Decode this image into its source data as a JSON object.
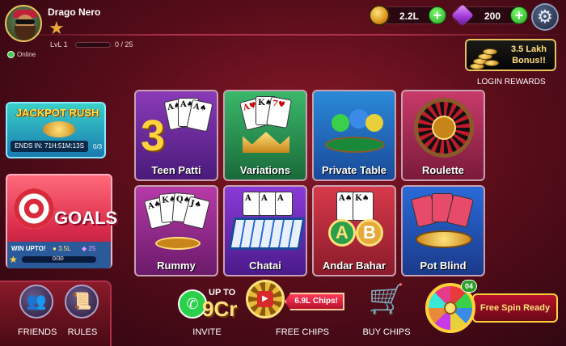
{
  "player": {
    "name": "Drago Nero",
    "level": "LvL 1",
    "xp_progress": "0 / 25",
    "xp_fraction": 0.0,
    "status": "Online"
  },
  "wallet": {
    "coins": "2.2L",
    "gems": "200"
  },
  "login_rewards": {
    "bonus_text": "3.5 Lakh Bonus!!",
    "label": "LOGIN REWARDS"
  },
  "jackpot": {
    "title": "JACKPOT RUSH",
    "timer": "ENDS IN: 71H:51M:13S",
    "count": "0/3"
  },
  "goals": {
    "title": "GOALS",
    "win_upto": "WIN UPTO!",
    "coin_reward": "3.5L",
    "gem_reward": "25",
    "progress": "0/30"
  },
  "games": [
    {
      "label": "Teen Patti"
    },
    {
      "label": "Variations"
    },
    {
      "label": "Private Table"
    },
    {
      "label": "Roulette"
    },
    {
      "label": "Rummy"
    },
    {
      "label": "Chatai"
    },
    {
      "label": "Andar Bahar"
    },
    {
      "label": "Pot Blind"
    }
  ],
  "bottom": {
    "friends": "FRIENDS",
    "rules": "RULES",
    "invite_upto": "UP TO",
    "invite_amount": "9Cr",
    "invite": "INVITE",
    "chips_amount": "6.9L Chips!",
    "free_chips": "FREE CHIPS",
    "buy_chips": "BUY CHIPS",
    "spin_badge": "04",
    "free_spin": "Free Spin Ready"
  },
  "icons": {
    "settings": "gear-icon",
    "friends": "friends-icon",
    "rules": "scroll-icon",
    "invite": "whatsapp-icon",
    "free_chips": "video-icon",
    "buy_chips": "cart-icon",
    "spin": "wheel-icon"
  }
}
